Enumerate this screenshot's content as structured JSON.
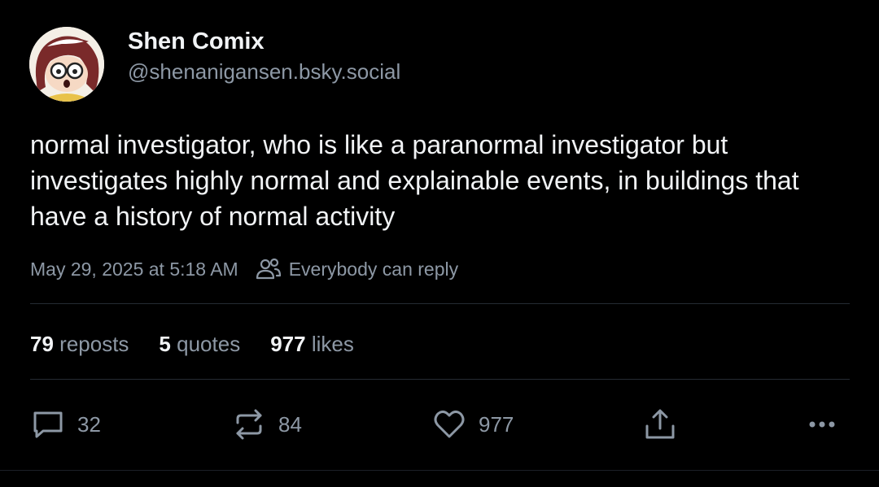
{
  "author": {
    "display_name": "Shen Comix",
    "handle": "@shenanigansen.bsky.social"
  },
  "post": {
    "text": "normal investigator, who is like a paranormal investigator but investigates highly normal and explainable events, in buildings that have a history of normal activity",
    "timestamp": "May 29, 2025 at 5:18 AM",
    "reply_setting": "Everybody can reply"
  },
  "stats": {
    "reposts_count": "79",
    "reposts_label": "reposts",
    "quotes_count": "5",
    "quotes_label": "quotes",
    "likes_count": "977",
    "likes_label": "likes"
  },
  "actions": {
    "reply_count": "32",
    "repost_count": "84",
    "like_count": "977"
  },
  "icons": {
    "reply": "speech-bubble-icon",
    "repost": "repost-arrows-icon",
    "like": "heart-icon",
    "share": "share-upload-icon",
    "more": "ellipsis-icon",
    "reply_setting": "people-icon"
  },
  "colors": {
    "background": "#000000",
    "text": "#f1f3f5",
    "muted": "#8d98a5",
    "divider": "#252b33"
  }
}
